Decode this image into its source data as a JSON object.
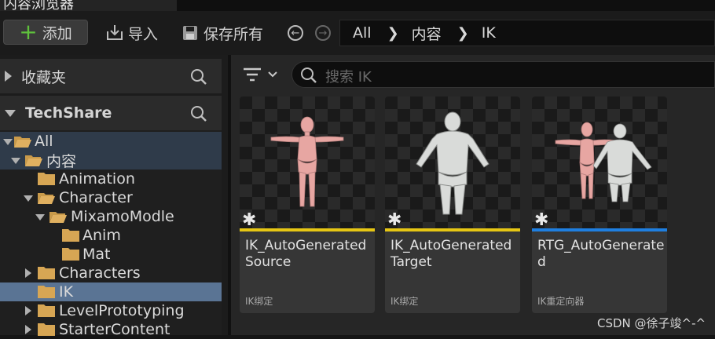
{
  "window": {
    "tab_title": "内容浏览器"
  },
  "toolbar": {
    "add_label": "添加",
    "import_label": "导入",
    "save_all_label": "保存所有"
  },
  "breadcrumb": [
    "All",
    "内容",
    "IK"
  ],
  "sidebar": {
    "favorites_label": "收藏夹",
    "project_label": "TechShare"
  },
  "tree": [
    {
      "label": "All",
      "state": "expanded"
    },
    {
      "label": "内容",
      "state": "expanded"
    },
    {
      "label": "Animation",
      "state": "leaf"
    },
    {
      "label": "Character",
      "state": "expanded"
    },
    {
      "label": "MixamoModle",
      "state": "expanded"
    },
    {
      "label": "Anim",
      "state": "leaf"
    },
    {
      "label": "Mat",
      "state": "leaf"
    },
    {
      "label": "Characters",
      "state": "collapsed"
    },
    {
      "label": "IK",
      "state": "leaf",
      "selected": true
    },
    {
      "label": "LevelPrototyping",
      "state": "collapsed"
    },
    {
      "label": "StarterContent",
      "state": "collapsed"
    }
  ],
  "search": {
    "placeholder": "搜索 IK"
  },
  "assets": [
    {
      "name": "IK_AutoGenerated\nSource",
      "type": "IK绑定",
      "stripe_color": "#e6c614",
      "figure": "pink"
    },
    {
      "name": "IK_AutoGenerated\nTarget",
      "type": "IK绑定",
      "stripe_color": "#e6c614",
      "figure": "white"
    },
    {
      "name": "RTG_AutoGenerated",
      "type": "IK重定向器",
      "stripe_color": "#1f7fe0",
      "figure": "both"
    }
  ],
  "watermark": "CSDN @徐子竣^-^",
  "colors": {
    "accent_selected": "#5a7494",
    "add_plus": "#5fc23c"
  }
}
